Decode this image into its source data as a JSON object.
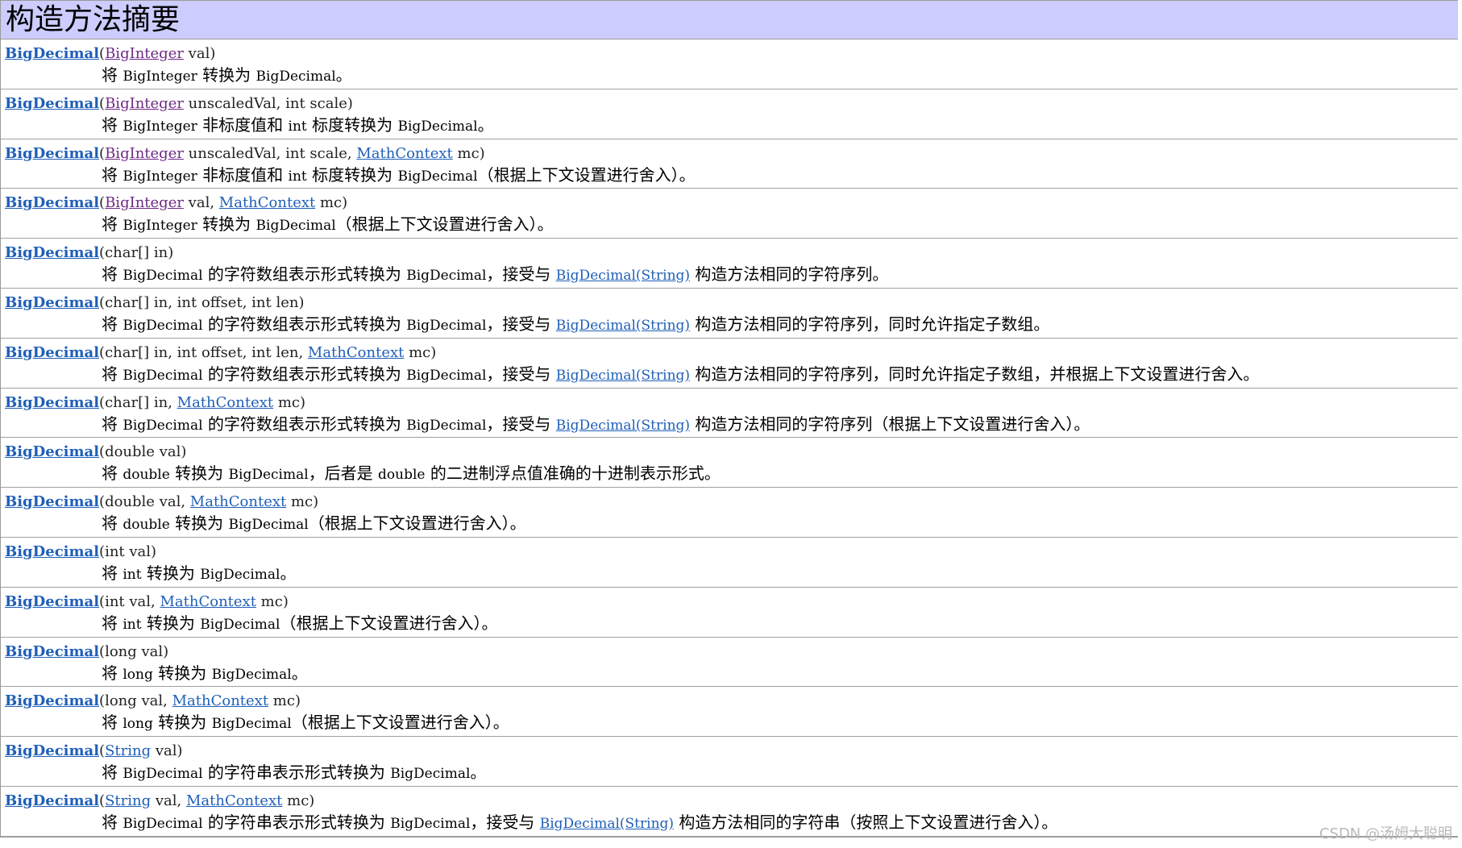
{
  "header": {
    "title": "构造方法摘要"
  },
  "rows": [
    {
      "sig": [
        {
          "t": "name",
          "v": "BigDecimal"
        },
        {
          "t": "plain",
          "v": "("
        },
        {
          "t": "visited",
          "v": "BigInteger"
        },
        {
          "t": "plain",
          "v": " val)"
        }
      ],
      "desc": [
        {
          "t": "plain",
          "v": "将 "
        },
        {
          "t": "code",
          "v": "BigInteger"
        },
        {
          "t": "plain",
          "v": " 转换为 "
        },
        {
          "t": "code",
          "v": "BigDecimal"
        },
        {
          "t": "plain",
          "v": "。"
        }
      ]
    },
    {
      "sig": [
        {
          "t": "name",
          "v": "BigDecimal"
        },
        {
          "t": "plain",
          "v": "("
        },
        {
          "t": "visited",
          "v": "BigInteger"
        },
        {
          "t": "plain",
          "v": " unscaledVal, int scale)"
        }
      ],
      "desc": [
        {
          "t": "plain",
          "v": "将 "
        },
        {
          "t": "code",
          "v": "BigInteger"
        },
        {
          "t": "plain",
          "v": " 非标度值和 "
        },
        {
          "t": "code",
          "v": "int"
        },
        {
          "t": "plain",
          "v": " 标度转换为 "
        },
        {
          "t": "code",
          "v": "BigDecimal"
        },
        {
          "t": "plain",
          "v": "。"
        }
      ]
    },
    {
      "sig": [
        {
          "t": "name",
          "v": "BigDecimal"
        },
        {
          "t": "plain",
          "v": "("
        },
        {
          "t": "visited",
          "v": "BigInteger"
        },
        {
          "t": "plain",
          "v": " unscaledVal, int scale, "
        },
        {
          "t": "link",
          "v": "MathContext"
        },
        {
          "t": "plain",
          "v": " mc)"
        }
      ],
      "desc": [
        {
          "t": "plain",
          "v": "将 "
        },
        {
          "t": "code",
          "v": "BigInteger"
        },
        {
          "t": "plain",
          "v": " 非标度值和 "
        },
        {
          "t": "code",
          "v": "int"
        },
        {
          "t": "plain",
          "v": " 标度转换为 "
        },
        {
          "t": "code",
          "v": "BigDecimal"
        },
        {
          "t": "plain",
          "v": "（根据上下文设置进行舍入）。"
        }
      ]
    },
    {
      "sig": [
        {
          "t": "name",
          "v": "BigDecimal"
        },
        {
          "t": "plain",
          "v": "("
        },
        {
          "t": "visited",
          "v": "BigInteger"
        },
        {
          "t": "plain",
          "v": " val, "
        },
        {
          "t": "link",
          "v": "MathContext"
        },
        {
          "t": "plain",
          "v": " mc)"
        }
      ],
      "desc": [
        {
          "t": "plain",
          "v": "将 "
        },
        {
          "t": "code",
          "v": "BigInteger"
        },
        {
          "t": "plain",
          "v": " 转换为 "
        },
        {
          "t": "code",
          "v": "BigDecimal"
        },
        {
          "t": "plain",
          "v": "（根据上下文设置进行舍入）。"
        }
      ]
    },
    {
      "sig": [
        {
          "t": "name",
          "v": "BigDecimal"
        },
        {
          "t": "plain",
          "v": "(char[] in)"
        }
      ],
      "desc": [
        {
          "t": "plain",
          "v": "将 "
        },
        {
          "t": "code",
          "v": "BigDecimal"
        },
        {
          "t": "plain",
          "v": " 的字符数组表示形式转换为 "
        },
        {
          "t": "code",
          "v": "BigDecimal"
        },
        {
          "t": "plain",
          "v": "，接受与 "
        },
        {
          "t": "link",
          "v": "BigDecimal(String)"
        },
        {
          "t": "plain",
          "v": " 构造方法相同的字符序列。"
        }
      ]
    },
    {
      "sig": [
        {
          "t": "name",
          "v": "BigDecimal"
        },
        {
          "t": "plain",
          "v": "(char[] in, int offset, int len)"
        }
      ],
      "desc": [
        {
          "t": "plain",
          "v": "将 "
        },
        {
          "t": "code",
          "v": "BigDecimal"
        },
        {
          "t": "plain",
          "v": " 的字符数组表示形式转换为 "
        },
        {
          "t": "code",
          "v": "BigDecimal"
        },
        {
          "t": "plain",
          "v": "，接受与 "
        },
        {
          "t": "link",
          "v": "BigDecimal(String)"
        },
        {
          "t": "plain",
          "v": " 构造方法相同的字符序列，同时允许指定子数组。"
        }
      ]
    },
    {
      "sig": [
        {
          "t": "name",
          "v": "BigDecimal"
        },
        {
          "t": "plain",
          "v": "(char[] in, int offset, int len, "
        },
        {
          "t": "link",
          "v": "MathContext"
        },
        {
          "t": "plain",
          "v": " mc)"
        }
      ],
      "desc": [
        {
          "t": "plain",
          "v": "将 "
        },
        {
          "t": "code",
          "v": "BigDecimal"
        },
        {
          "t": "plain",
          "v": " 的字符数组表示形式转换为 "
        },
        {
          "t": "code",
          "v": "BigDecimal"
        },
        {
          "t": "plain",
          "v": "，接受与 "
        },
        {
          "t": "link",
          "v": "BigDecimal(String)"
        },
        {
          "t": "plain",
          "v": " 构造方法相同的字符序列，同时允许指定子数组，并根据上下文设置进行舍入。"
        }
      ]
    },
    {
      "sig": [
        {
          "t": "name",
          "v": "BigDecimal"
        },
        {
          "t": "plain",
          "v": "(char[] in, "
        },
        {
          "t": "link",
          "v": "MathContext"
        },
        {
          "t": "plain",
          "v": " mc)"
        }
      ],
      "desc": [
        {
          "t": "plain",
          "v": "将 "
        },
        {
          "t": "code",
          "v": "BigDecimal"
        },
        {
          "t": "plain",
          "v": " 的字符数组表示形式转换为 "
        },
        {
          "t": "code",
          "v": "BigDecimal"
        },
        {
          "t": "plain",
          "v": "，接受与 "
        },
        {
          "t": "link",
          "v": "BigDecimal(String)"
        },
        {
          "t": "plain",
          "v": " 构造方法相同的字符序列（根据上下文设置进行舍入）。"
        }
      ]
    },
    {
      "sig": [
        {
          "t": "name",
          "v": "BigDecimal"
        },
        {
          "t": "plain",
          "v": "(double val)"
        }
      ],
      "desc": [
        {
          "t": "plain",
          "v": "将 "
        },
        {
          "t": "code",
          "v": "double"
        },
        {
          "t": "plain",
          "v": " 转换为 "
        },
        {
          "t": "code",
          "v": "BigDecimal"
        },
        {
          "t": "plain",
          "v": "，后者是 "
        },
        {
          "t": "code",
          "v": "double"
        },
        {
          "t": "plain",
          "v": " 的二进制浮点值准确的十进制表示形式。"
        }
      ]
    },
    {
      "sig": [
        {
          "t": "name",
          "v": "BigDecimal"
        },
        {
          "t": "plain",
          "v": "(double val, "
        },
        {
          "t": "link",
          "v": "MathContext"
        },
        {
          "t": "plain",
          "v": " mc)"
        }
      ],
      "desc": [
        {
          "t": "plain",
          "v": "将 "
        },
        {
          "t": "code",
          "v": "double"
        },
        {
          "t": "plain",
          "v": " 转换为 "
        },
        {
          "t": "code",
          "v": "BigDecimal"
        },
        {
          "t": "plain",
          "v": "（根据上下文设置进行舍入）。"
        }
      ]
    },
    {
      "sig": [
        {
          "t": "name",
          "v": "BigDecimal"
        },
        {
          "t": "plain",
          "v": "(int val)"
        }
      ],
      "desc": [
        {
          "t": "plain",
          "v": "将 "
        },
        {
          "t": "code",
          "v": "int"
        },
        {
          "t": "plain",
          "v": " 转换为 "
        },
        {
          "t": "code",
          "v": "BigDecimal"
        },
        {
          "t": "plain",
          "v": "。"
        }
      ]
    },
    {
      "sig": [
        {
          "t": "name",
          "v": "BigDecimal"
        },
        {
          "t": "plain",
          "v": "(int val, "
        },
        {
          "t": "link",
          "v": "MathContext"
        },
        {
          "t": "plain",
          "v": " mc)"
        }
      ],
      "desc": [
        {
          "t": "plain",
          "v": "将 "
        },
        {
          "t": "code",
          "v": "int"
        },
        {
          "t": "plain",
          "v": " 转换为 "
        },
        {
          "t": "code",
          "v": "BigDecimal"
        },
        {
          "t": "plain",
          "v": "（根据上下文设置进行舍入）。"
        }
      ]
    },
    {
      "sig": [
        {
          "t": "name",
          "v": "BigDecimal"
        },
        {
          "t": "plain",
          "v": "(long val)"
        }
      ],
      "desc": [
        {
          "t": "plain",
          "v": "将 "
        },
        {
          "t": "code",
          "v": "long"
        },
        {
          "t": "plain",
          "v": " 转换为 "
        },
        {
          "t": "code",
          "v": "BigDecimal"
        },
        {
          "t": "plain",
          "v": "。"
        }
      ]
    },
    {
      "sig": [
        {
          "t": "name",
          "v": "BigDecimal"
        },
        {
          "t": "plain",
          "v": "(long val, "
        },
        {
          "t": "link",
          "v": "MathContext"
        },
        {
          "t": "plain",
          "v": " mc)"
        }
      ],
      "desc": [
        {
          "t": "plain",
          "v": "将 "
        },
        {
          "t": "code",
          "v": "long"
        },
        {
          "t": "plain",
          "v": " 转换为 "
        },
        {
          "t": "code",
          "v": "BigDecimal"
        },
        {
          "t": "plain",
          "v": "（根据上下文设置进行舍入）。"
        }
      ]
    },
    {
      "sig": [
        {
          "t": "name",
          "v": "BigDecimal"
        },
        {
          "t": "plain",
          "v": "("
        },
        {
          "t": "link",
          "v": "String"
        },
        {
          "t": "plain",
          "v": " val)"
        }
      ],
      "desc": [
        {
          "t": "plain",
          "v": "将 "
        },
        {
          "t": "code",
          "v": "BigDecimal"
        },
        {
          "t": "plain",
          "v": " 的字符串表示形式转换为 "
        },
        {
          "t": "code",
          "v": "BigDecimal"
        },
        {
          "t": "plain",
          "v": "。"
        }
      ]
    },
    {
      "sig": [
        {
          "t": "name",
          "v": "BigDecimal"
        },
        {
          "t": "plain",
          "v": "("
        },
        {
          "t": "link",
          "v": "String"
        },
        {
          "t": "plain",
          "v": " val, "
        },
        {
          "t": "link",
          "v": "MathContext"
        },
        {
          "t": "plain",
          "v": " mc)"
        }
      ],
      "desc": [
        {
          "t": "plain",
          "v": "将 "
        },
        {
          "t": "code",
          "v": "BigDecimal"
        },
        {
          "t": "plain",
          "v": " 的字符串表示形式转换为 "
        },
        {
          "t": "code",
          "v": "BigDecimal"
        },
        {
          "t": "plain",
          "v": "，接受与 "
        },
        {
          "t": "link",
          "v": "BigDecimal(String)"
        },
        {
          "t": "plain",
          "v": " 构造方法相同的字符串（按照上下文设置进行舍入）。"
        }
      ]
    }
  ],
  "watermark": "CSDN @汤姆大聪明"
}
